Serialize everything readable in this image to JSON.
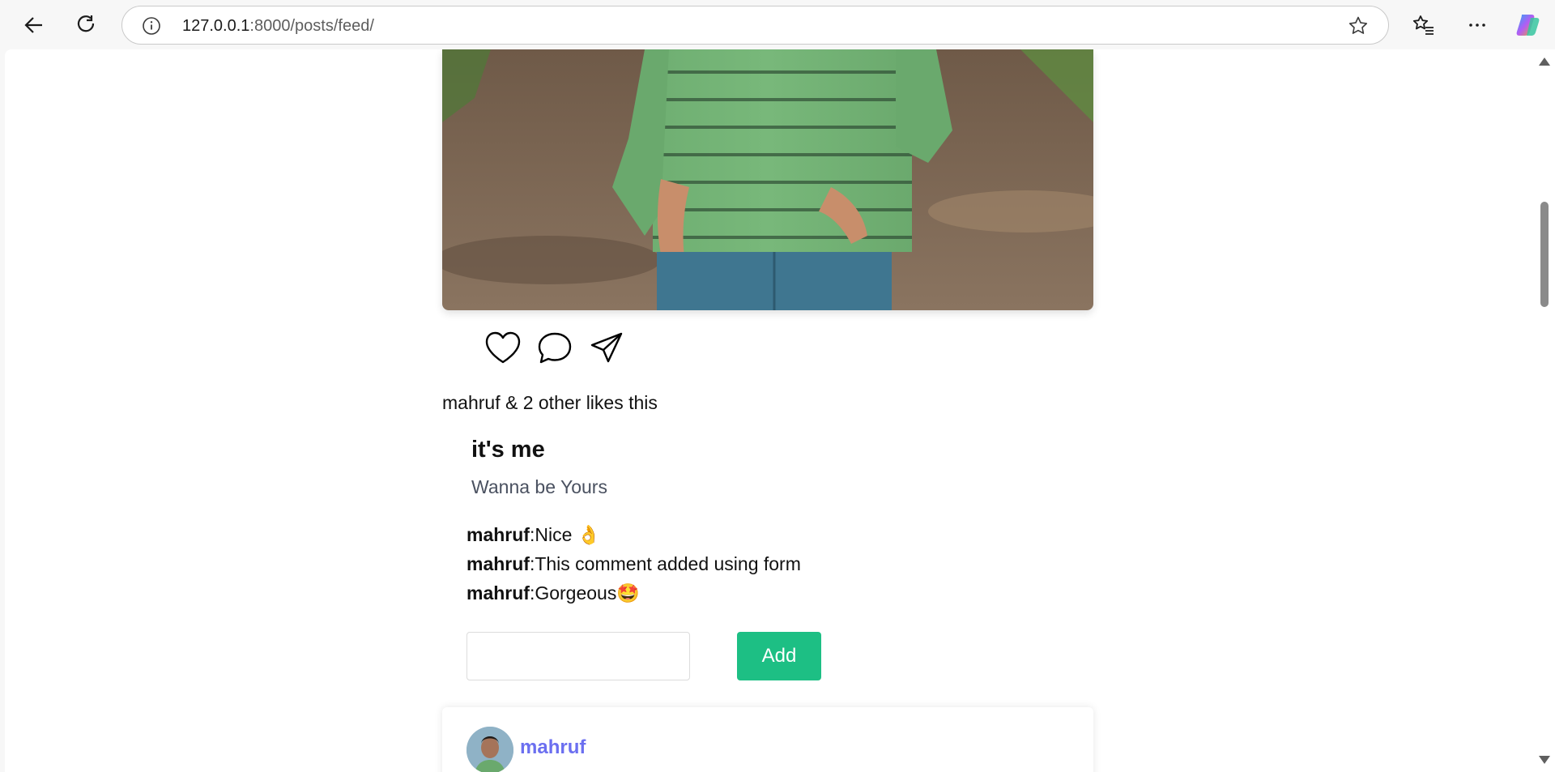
{
  "browser": {
    "url_host": "127.0.0.1",
    "url_path": ":8000/posts/feed/"
  },
  "post": {
    "likes_text": "mahruf & 2 other likes this",
    "title": "it's me",
    "subtitle": "Wanna be Yours",
    "comments": [
      {
        "user": "mahruf",
        "text": ":Nice 👌"
      },
      {
        "user": "mahruf",
        "text": ":This comment added using form"
      },
      {
        "user": "mahruf",
        "text": ":Gorgeous🤩"
      }
    ],
    "comment_input_value": "",
    "add_label": "Add"
  },
  "next_post": {
    "author": "mahruf"
  },
  "colors": {
    "accent_green": "#1dbf84",
    "author_purple": "#6b6ff0"
  }
}
